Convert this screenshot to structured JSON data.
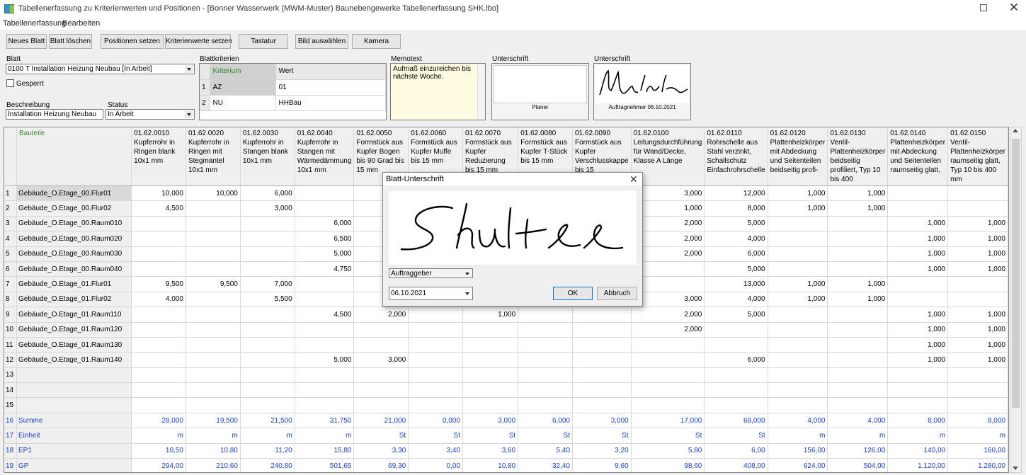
{
  "window": {
    "title": "Tabellenerfassung zu Kriterienwerten und Positionen - [Bonner Wasserwerk (MWM-Muster) Bauneben­gewerke Tabellenerfassung SHK.lbo]",
    "close": "✕"
  },
  "menu": [
    "Tabellenerfassung",
    "Bearbeiten"
  ],
  "toolbar": [
    "Neues Blatt",
    "Blatt löschen",
    "Positionen setzen",
    "Kriterienwerte setzen",
    "Tastatur",
    "Bild auswählen",
    "Kamera"
  ],
  "blatt": {
    "label": "Blatt",
    "value": "0100 T  Installation Heizung Neubau  [In Arbeit]",
    "gesperrt_label": "Gesperrt",
    "beschreibung_label": "Beschreibung",
    "beschreibung_value": "Installation Heizung Neubau",
    "status_label": "Status",
    "status_value": "In Arbeit"
  },
  "blattkriterien": {
    "label": "Blattkriterien",
    "headers": [
      "Kriterium",
      "Wert"
    ],
    "rows": [
      [
        "1",
        "AZ",
        "01"
      ],
      [
        "2",
        "NU",
        "HHBau"
      ]
    ]
  },
  "memo": {
    "label": "Memotext",
    "text": "Aufmaß einzureichen bis nächste Woche."
  },
  "unterschrift1": {
    "label": "Unterschrift",
    "caption": "Planer"
  },
  "unterschrift2": {
    "label": "Unterschrift",
    "caption": "Auftragnehmer  06.10.2021"
  },
  "grid": {
    "corner_label": "Bauteile",
    "columns": [
      "01.62.0010 Kupferrohr in Ringen blank 10x1 mm",
      "01.62.0020 Kupferrohr in Ringen mit Stegmantel 10x1 mm",
      "01.62.0030 Kupferrohr in Stangen blank 10x1 mm",
      "01.62.0040 Kupferrohr in Stangen mit Wärmedämmung 10x1 mm",
      "01.62.0050 Formstück aus Kupfer Bogen bis 90 Grad bis 15 mm",
      "01.62.0060 Formstück aus Kupfer Muffe bis 15 mm",
      "01.62.0070 Formstück aus Kupfer Reduzierung bis 15 mm",
      "01.62.0080 Formstück aus Kupfer T-Stück bis 15 mm",
      "01.62.0090 Formstück aus Kupfer Verschlusskappe bis 15",
      "01.62.0100 Leitungsdurchführung für Wand/Decke, Klasse A Länge",
      "01.62.0110 Rohrschelle aus Stahl verzinkt, Schallschutz Einfachrohrschelle",
      "01.62.0120 Plattenheizkörper mit Abdeckung und Seitenteilen beidseitig profi-",
      "01.62.0130 Ventil-Plattenheizkörper beidseitig profiliert, Typ 10 bis 400",
      "01.62.0140 Plattenheizkörper mit Abdeckung und Seitenteilen raumseitig glatt,",
      "01.62.0150 Ventil-Plattenheizkörper raumseitig glatt, Typ 10 bis 400 mm"
    ],
    "rows": [
      {
        "n": "1",
        "name": "Gebäude_O.Etage_00.Flur01",
        "cells": [
          "10,000",
          "10,000",
          "6,000",
          "",
          "",
          "",
          "",
          "",
          "",
          "3,000",
          "12,000",
          "1,000",
          "1,000",
          "",
          ""
        ]
      },
      {
        "n": "2",
        "name": "Gebäude_O.Etage_00.Flur02",
        "cells": [
          "4,500",
          "",
          "3,000",
          "",
          "",
          "",
          "",
          "",
          "",
          "1,000",
          "8,000",
          "1,000",
          "1,000",
          "",
          ""
        ]
      },
      {
        "n": "3",
        "name": "Gebäude_O.Etage_00.Raum010",
        "cells": [
          "",
          "",
          "",
          "6,000",
          "",
          "",
          "",
          "",
          "",
          "2,000",
          "5,000",
          "",
          "",
          "1,000",
          "1,000"
        ]
      },
      {
        "n": "4",
        "name": "Gebäude_O.Etage_00.Raum020",
        "cells": [
          "",
          "",
          "",
          "6,500",
          "",
          "",
          "",
          "",
          "",
          "2,000",
          "4,000",
          "",
          "",
          "1,000",
          "1,000"
        ]
      },
      {
        "n": "5",
        "name": "Gebäude_O.Etage_00.Raum030",
        "cells": [
          "",
          "",
          "",
          "5,000",
          "",
          "",
          "",
          "",
          "",
          "2,000",
          "6,000",
          "",
          "",
          "1,000",
          "1,000"
        ]
      },
      {
        "n": "6",
        "name": "Gebäude_O.Etage_00.Raum040",
        "cells": [
          "",
          "",
          "",
          "4,750",
          "",
          "",
          "",
          "",
          "",
          "",
          "5,000",
          "",
          "",
          "1,000",
          "1,000"
        ]
      },
      {
        "n": "7",
        "name": "Gebäude_O.Etage_01.Flur01",
        "cells": [
          "9,500",
          "9,500",
          "7,000",
          "",
          "",
          "",
          "",
          "",
          "",
          "",
          "13,000",
          "1,000",
          "1,000",
          "",
          ""
        ]
      },
      {
        "n": "8",
        "name": "Gebäude_O.Etage_01.Flur02",
        "cells": [
          "4,000",
          "",
          "5,500",
          "",
          "",
          "",
          "",
          "",
          "",
          "3,000",
          "4,000",
          "1,000",
          "1,000",
          "",
          ""
        ]
      },
      {
        "n": "9",
        "name": "Gebäude_O.Etage_01.Raum110",
        "cells": [
          "",
          "",
          "",
          "4,500",
          "2,000",
          "",
          "1,000",
          "",
          "",
          "2,000",
          "5,000",
          "",
          "",
          "1,000",
          "1,000"
        ]
      },
      {
        "n": "10",
        "name": "Gebäude_O.Etage_01.Raum120",
        "cells": [
          "",
          "",
          "",
          "",
          "",
          "",
          "",
          "",
          "",
          "2,000",
          "",
          "",
          "",
          "1,000",
          "1,000"
        ]
      },
      {
        "n": "11",
        "name": "Gebäude_O.Etage_01.Raum130",
        "cells": [
          "",
          "",
          "",
          "",
          "",
          "",
          "",
          "",
          "",
          "",
          "",
          "",
          "",
          "1,000",
          "1,000"
        ]
      },
      {
        "n": "12",
        "name": "Gebäude_O.Etage_01.Raum140",
        "cells": [
          "",
          "",
          "",
          "5,000",
          "3,000",
          "",
          "",
          "",
          "",
          "",
          "6,000",
          "",
          "",
          "1,000",
          "1,000"
        ]
      },
      {
        "n": "13",
        "name": "",
        "cells": [
          "",
          "",
          "",
          "",
          "",
          "",
          "",
          "",
          "",
          "",
          "",
          "",
          "",
          "",
          ""
        ]
      },
      {
        "n": "14",
        "name": "",
        "cells": [
          "",
          "",
          "",
          "",
          "",
          "",
          "",
          "",
          "",
          "",
          "",
          "",
          "",
          "",
          ""
        ]
      },
      {
        "n": "15",
        "name": "",
        "cells": [
          "",
          "",
          "",
          "",
          "",
          "",
          "",
          "",
          "",
          "",
          "",
          "",
          "",
          "",
          ""
        ]
      },
      {
        "n": "16",
        "name": "Summe",
        "blue": true,
        "cells": [
          "28,000",
          "19,500",
          "21,500",
          "31,750",
          "21,000",
          "0,000",
          "3,000",
          "6,000",
          "3,000",
          "17,000",
          "68,000",
          "4,000",
          "4,000",
          "8,000",
          "8,000"
        ]
      },
      {
        "n": "17",
        "name": "Einheit",
        "blue": true,
        "cells": [
          "m",
          "m",
          "m",
          "m",
          "St",
          "St",
          "St",
          "St",
          "St",
          "St",
          "St",
          "m",
          "m",
          "m",
          "m"
        ]
      },
      {
        "n": "18",
        "name": "EP1",
        "blue": true,
        "cells": [
          "10,50",
          "10,80",
          "11,20",
          "15,80",
          "3,30",
          "3,40",
          "3,60",
          "5,40",
          "3,20",
          "5,80",
          "6,00",
          "156,00",
          "126,00",
          "140,00",
          "160,00"
        ]
      },
      {
        "n": "19",
        "name": "GP",
        "blue": true,
        "cells": [
          "294,00",
          "210,60",
          "240,80",
          "501,65",
          "69,30",
          "0,00",
          "10,80",
          "32,40",
          "9,60",
          "98,60",
          "408,00",
          "624,00",
          "504,00",
          "1.120,00",
          "1.280,00"
        ]
      }
    ]
  },
  "dialog": {
    "title": "Blatt-Unterschrift",
    "close": "✕",
    "role_value": "Auftraggeber",
    "date_value": "06.10.2021",
    "ok": "OK",
    "cancel": "Abbruch"
  }
}
